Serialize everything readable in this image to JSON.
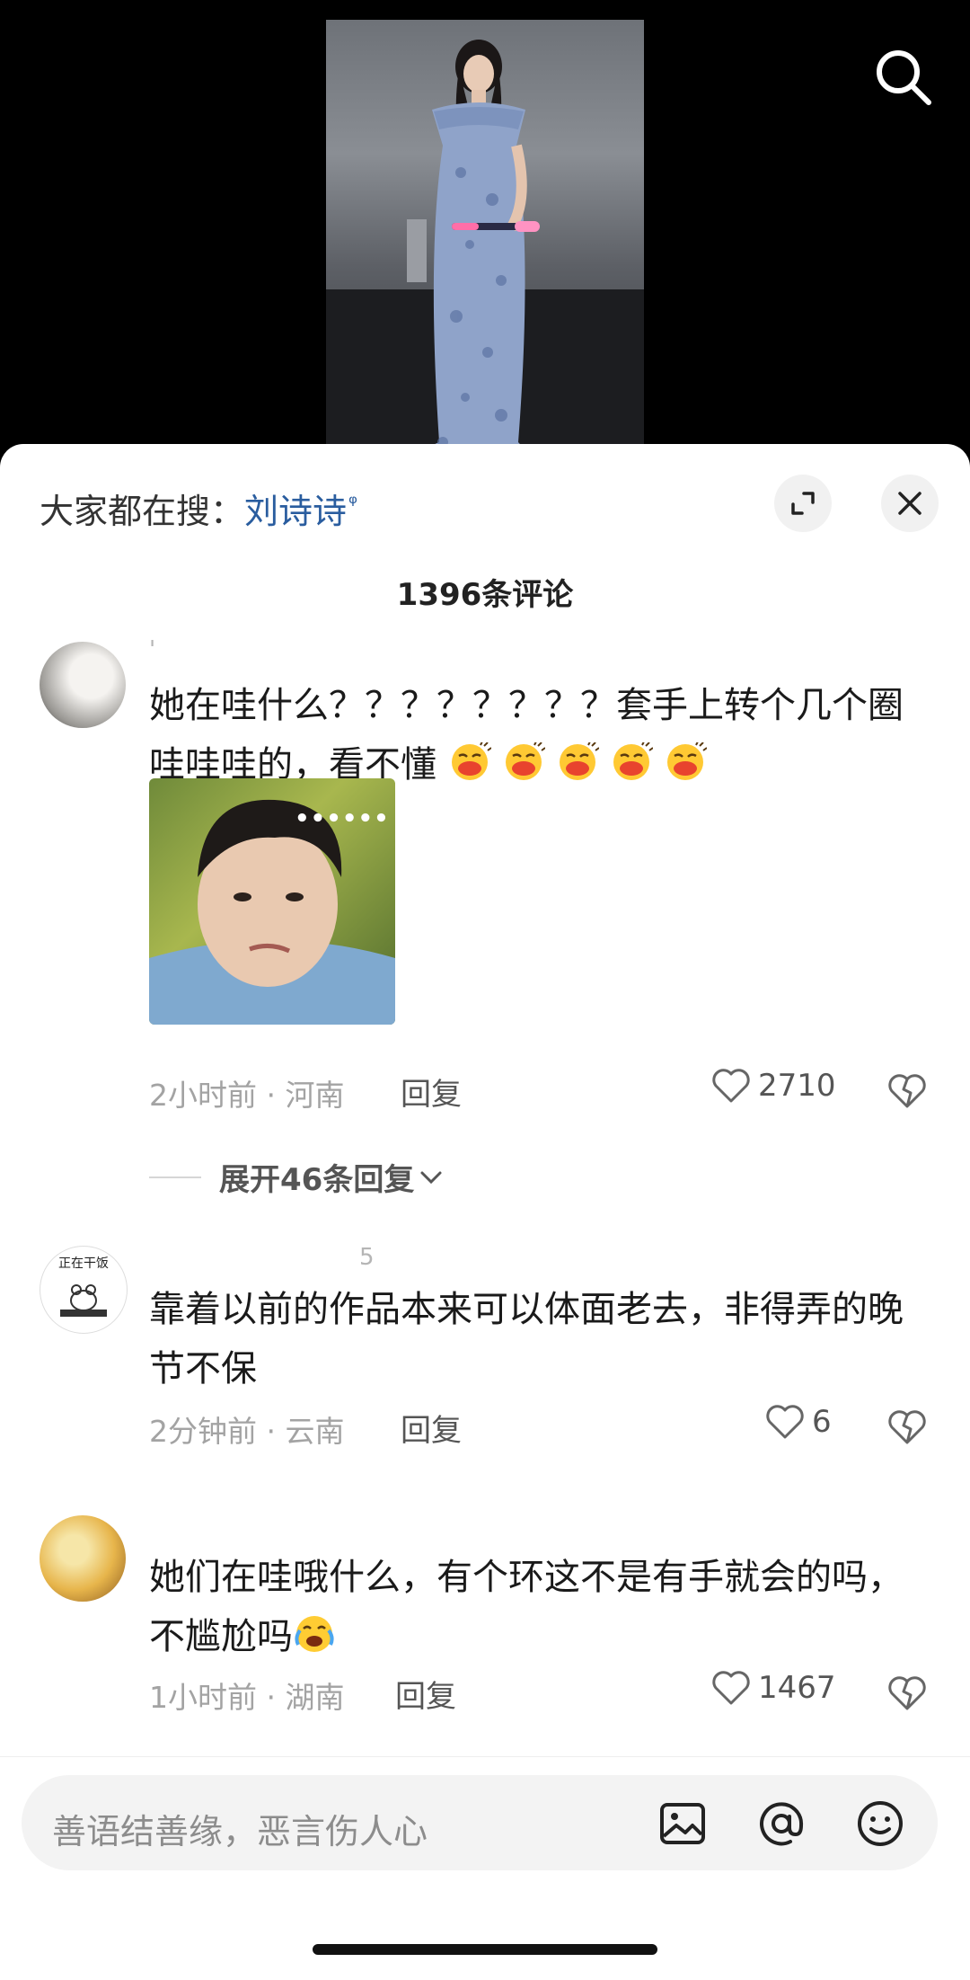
{
  "trending": {
    "prefix": "大家都在搜：",
    "keyword": "刘诗诗",
    "search_glyph": "ᵠ"
  },
  "comments_header": {
    "count_text": "1396条评论"
  },
  "comments": [
    {
      "username": "ꞌ",
      "text_part1": "她在哇什么？？？？？？？？套手上转个几个圈哇哇哇的，看不懂",
      "emoji_icon": "tongue-out-emoji",
      "emoji_count": 5,
      "sticker_overlay": "••••••",
      "time": "2小时前",
      "location": "河南",
      "reply_label": "回复",
      "likes": "2710"
    },
    {
      "username": "5",
      "avatar_text": "正在干饭",
      "text": "靠着以前的作品本来可以体面老去，非得弄的晚节不保",
      "time": "2分钟前",
      "location": "云南",
      "reply_label": "回复",
      "likes": "6"
    },
    {
      "username": "",
      "text": "她们在哇哦什么，有个环这不是有手就会的吗，不尴尬吗",
      "emoji_icon": "crying-laughing-emoji",
      "time": "1小时前",
      "location": "湖南",
      "reply_label": "回复",
      "likes": "1467"
    }
  ],
  "expand_replies_label": "展开46条回复",
  "meta_separator": " · ",
  "input": {
    "placeholder": "善语结善缘，恶言伤人心"
  },
  "colors": {
    "keyword": "#2a5d9f",
    "meta": "#a3a3a3",
    "sheet_bg": "#ffffff",
    "video_bg": "#000000"
  }
}
